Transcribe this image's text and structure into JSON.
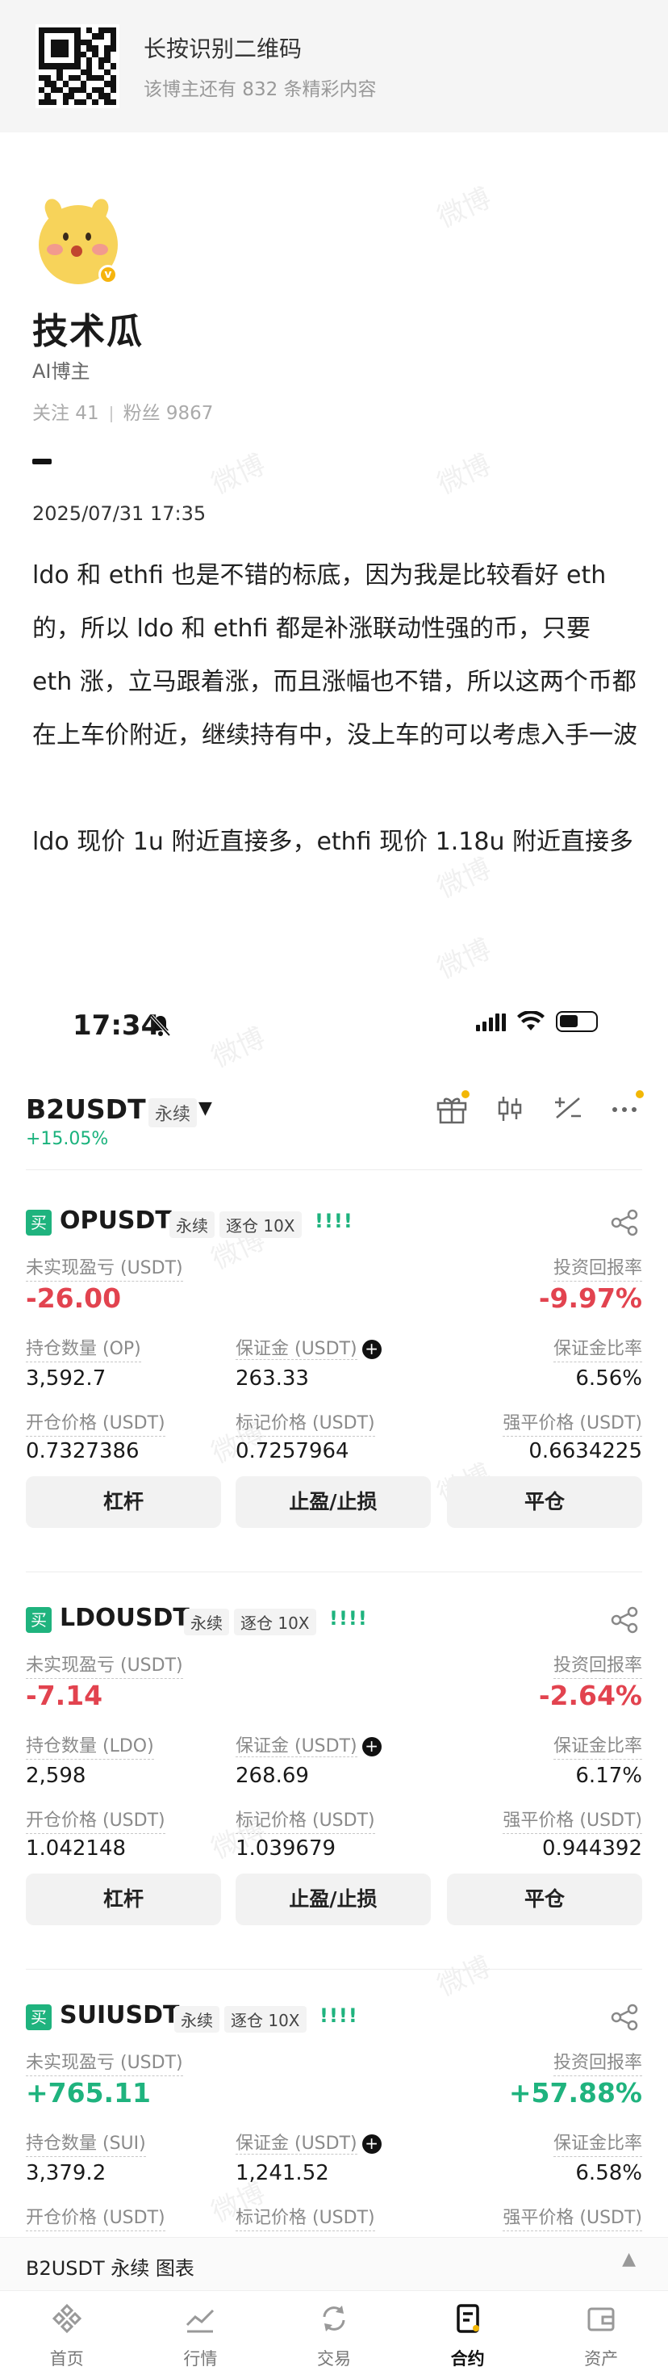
{
  "qr_banner": {
    "title": "长按识别二维码",
    "subtitle": "该博主还有 832 条精彩内容"
  },
  "profile": {
    "name": "技术瓜",
    "role": "AI博主",
    "following_label": "关注 41",
    "fans_label": "粉丝 9867",
    "badge_icon": "verified-v-icon"
  },
  "post": {
    "date": "2025/07/31 17:35",
    "paragraphs": [
      "ldo 和 ethfi 也是不错的标底，因为我是比较看好 eth 的，所以 ldo 和 ethfi 都是补涨联动性强的币，只要 eth 涨，立马跟着涨，而且涨幅也不错，所以这两个币都在上车价附近，继续持有中，没上车的可以考虑入手一波",
      "ldo 现价 1u 附近直接多，ethfi 现价 1.18u 附近直接多"
    ]
  },
  "watermark": "微博",
  "app": {
    "status_time": "17:34",
    "pair": {
      "name": "B2USDT",
      "type": "永续",
      "change": "+15.05%"
    },
    "header_icons": [
      "gift-icon",
      "candlestick-icon",
      "calculator-icon",
      "more-icon"
    ],
    "labels": {
      "buy": "买",
      "perpetual": "永续",
      "margin_mode": "逐仓 10X",
      "bars": "!!!!",
      "unrealized": "未实现盈亏 (USDT)",
      "roi": "投资回报率",
      "margin": "保证金 (USDT)",
      "margin_ratio": "保证金比率",
      "entry_price": "开仓价格 (USDT)",
      "mark_price": "标记价格 (USDT)",
      "liq_price": "强平价格 (USDT)",
      "btn_leverage": "杠杆",
      "btn_tpsl": "止盈/止损",
      "btn_close": "平仓"
    },
    "positions": [
      {
        "symbol": "OPUSDT",
        "pnl": "-26.00",
        "roi": "-9.97%",
        "qty_label": "持仓数量 (OP)",
        "qty": "3,592.7",
        "margin": "263.33",
        "margin_ratio": "6.56%",
        "entry": "0.7327386",
        "mark": "0.7257964",
        "liq": "0.6634225"
      },
      {
        "symbol": "LDOUSDT",
        "pnl": "-7.14",
        "roi": "-2.64%",
        "qty_label": "持仓数量 (LDO)",
        "qty": "2,598",
        "margin": "268.69",
        "margin_ratio": "6.17%",
        "entry": "1.042148",
        "mark": "1.039679",
        "liq": "0.944392"
      },
      {
        "symbol": "SUIUSDT",
        "pnl": "+765.11",
        "roi": "+57.88%",
        "qty_label": "持仓数量 (SUI)",
        "qty": "3,379.2",
        "margin": "1,241.52",
        "margin_ratio": "6.58%"
      }
    ],
    "chart_bar": "B2USDT 永续  图表",
    "nav": [
      {
        "label": "首页",
        "icon": "binance-logo-icon"
      },
      {
        "label": "行情",
        "icon": "market-chart-icon"
      },
      {
        "label": "交易",
        "icon": "trade-swap-icon"
      },
      {
        "label": "合约",
        "icon": "futures-icon"
      },
      {
        "label": "资产",
        "icon": "wallet-icon"
      }
    ]
  }
}
